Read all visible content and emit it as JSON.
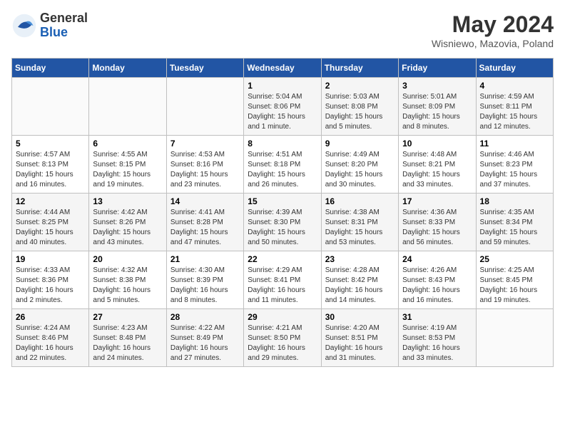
{
  "header": {
    "logo_general": "General",
    "logo_blue": "Blue",
    "month_title": "May 2024",
    "location": "Wisniewo, Mazovia, Poland"
  },
  "days_of_week": [
    "Sunday",
    "Monday",
    "Tuesday",
    "Wednesday",
    "Thursday",
    "Friday",
    "Saturday"
  ],
  "weeks": [
    {
      "row_class": "row-1",
      "days": [
        {
          "num": "",
          "info": ""
        },
        {
          "num": "",
          "info": ""
        },
        {
          "num": "",
          "info": ""
        },
        {
          "num": "1",
          "info": "Sunrise: 5:04 AM\nSunset: 8:06 PM\nDaylight: 15 hours\nand 1 minute."
        },
        {
          "num": "2",
          "info": "Sunrise: 5:03 AM\nSunset: 8:08 PM\nDaylight: 15 hours\nand 5 minutes."
        },
        {
          "num": "3",
          "info": "Sunrise: 5:01 AM\nSunset: 8:09 PM\nDaylight: 15 hours\nand 8 minutes."
        },
        {
          "num": "4",
          "info": "Sunrise: 4:59 AM\nSunset: 8:11 PM\nDaylight: 15 hours\nand 12 minutes."
        }
      ]
    },
    {
      "row_class": "row-2",
      "days": [
        {
          "num": "5",
          "info": "Sunrise: 4:57 AM\nSunset: 8:13 PM\nDaylight: 15 hours\nand 16 minutes."
        },
        {
          "num": "6",
          "info": "Sunrise: 4:55 AM\nSunset: 8:15 PM\nDaylight: 15 hours\nand 19 minutes."
        },
        {
          "num": "7",
          "info": "Sunrise: 4:53 AM\nSunset: 8:16 PM\nDaylight: 15 hours\nand 23 minutes."
        },
        {
          "num": "8",
          "info": "Sunrise: 4:51 AM\nSunset: 8:18 PM\nDaylight: 15 hours\nand 26 minutes."
        },
        {
          "num": "9",
          "info": "Sunrise: 4:49 AM\nSunset: 8:20 PM\nDaylight: 15 hours\nand 30 minutes."
        },
        {
          "num": "10",
          "info": "Sunrise: 4:48 AM\nSunset: 8:21 PM\nDaylight: 15 hours\nand 33 minutes."
        },
        {
          "num": "11",
          "info": "Sunrise: 4:46 AM\nSunset: 8:23 PM\nDaylight: 15 hours\nand 37 minutes."
        }
      ]
    },
    {
      "row_class": "row-3",
      "days": [
        {
          "num": "12",
          "info": "Sunrise: 4:44 AM\nSunset: 8:25 PM\nDaylight: 15 hours\nand 40 minutes."
        },
        {
          "num": "13",
          "info": "Sunrise: 4:42 AM\nSunset: 8:26 PM\nDaylight: 15 hours\nand 43 minutes."
        },
        {
          "num": "14",
          "info": "Sunrise: 4:41 AM\nSunset: 8:28 PM\nDaylight: 15 hours\nand 47 minutes."
        },
        {
          "num": "15",
          "info": "Sunrise: 4:39 AM\nSunset: 8:30 PM\nDaylight: 15 hours\nand 50 minutes."
        },
        {
          "num": "16",
          "info": "Sunrise: 4:38 AM\nSunset: 8:31 PM\nDaylight: 15 hours\nand 53 minutes."
        },
        {
          "num": "17",
          "info": "Sunrise: 4:36 AM\nSunset: 8:33 PM\nDaylight: 15 hours\nand 56 minutes."
        },
        {
          "num": "18",
          "info": "Sunrise: 4:35 AM\nSunset: 8:34 PM\nDaylight: 15 hours\nand 59 minutes."
        }
      ]
    },
    {
      "row_class": "row-4",
      "days": [
        {
          "num": "19",
          "info": "Sunrise: 4:33 AM\nSunset: 8:36 PM\nDaylight: 16 hours\nand 2 minutes."
        },
        {
          "num": "20",
          "info": "Sunrise: 4:32 AM\nSunset: 8:38 PM\nDaylight: 16 hours\nand 5 minutes."
        },
        {
          "num": "21",
          "info": "Sunrise: 4:30 AM\nSunset: 8:39 PM\nDaylight: 16 hours\nand 8 minutes."
        },
        {
          "num": "22",
          "info": "Sunrise: 4:29 AM\nSunset: 8:41 PM\nDaylight: 16 hours\nand 11 minutes."
        },
        {
          "num": "23",
          "info": "Sunrise: 4:28 AM\nSunset: 8:42 PM\nDaylight: 16 hours\nand 14 minutes."
        },
        {
          "num": "24",
          "info": "Sunrise: 4:26 AM\nSunset: 8:43 PM\nDaylight: 16 hours\nand 16 minutes."
        },
        {
          "num": "25",
          "info": "Sunrise: 4:25 AM\nSunset: 8:45 PM\nDaylight: 16 hours\nand 19 minutes."
        }
      ]
    },
    {
      "row_class": "row-5",
      "days": [
        {
          "num": "26",
          "info": "Sunrise: 4:24 AM\nSunset: 8:46 PM\nDaylight: 16 hours\nand 22 minutes."
        },
        {
          "num": "27",
          "info": "Sunrise: 4:23 AM\nSunset: 8:48 PM\nDaylight: 16 hours\nand 24 minutes."
        },
        {
          "num": "28",
          "info": "Sunrise: 4:22 AM\nSunset: 8:49 PM\nDaylight: 16 hours\nand 27 minutes."
        },
        {
          "num": "29",
          "info": "Sunrise: 4:21 AM\nSunset: 8:50 PM\nDaylight: 16 hours\nand 29 minutes."
        },
        {
          "num": "30",
          "info": "Sunrise: 4:20 AM\nSunset: 8:51 PM\nDaylight: 16 hours\nand 31 minutes."
        },
        {
          "num": "31",
          "info": "Sunrise: 4:19 AM\nSunset: 8:53 PM\nDaylight: 16 hours\nand 33 minutes."
        },
        {
          "num": "",
          "info": ""
        }
      ]
    }
  ]
}
